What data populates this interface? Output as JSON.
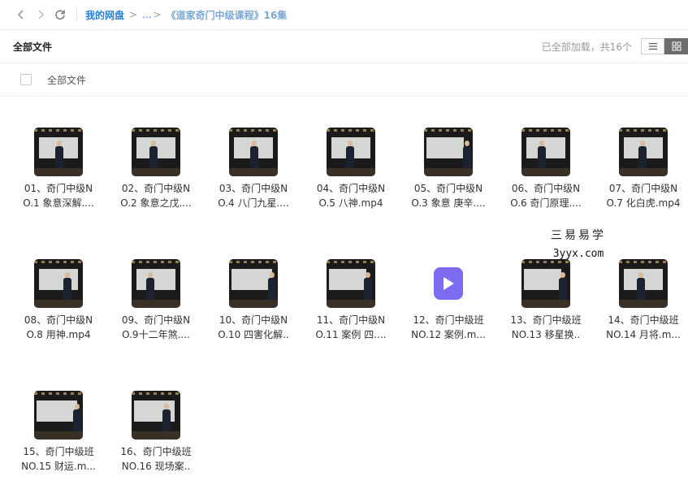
{
  "topbar": {
    "back_icon": "chevron-left-icon",
    "forward_icon": "chevron-right-icon",
    "refresh_icon": "refresh-icon",
    "breadcrumb": {
      "root": "我的网盘",
      "ellipsis": "...",
      "current": "《道家奇门中级课程》16集"
    }
  },
  "header": {
    "title": "全部文件",
    "status": "已全部加载，共16个",
    "view_list_icon": "list-view-icon",
    "view_grid_icon": "grid-view-icon"
  },
  "select_all": {
    "label": "全部文件"
  },
  "files": [
    {
      "line1": "01、奇门中级N",
      "line2": "O.1 象意深解...."
    },
    {
      "line1": "02、奇门中级N",
      "line2": "O.2 象意之戊...."
    },
    {
      "line1": "03、奇门中级N",
      "line2": "O.4 八门九星...."
    },
    {
      "line1": "04、奇门中级N",
      "line2": "O.5 八神.mp4"
    },
    {
      "line1": "05、奇门中级N",
      "line2": "O.3 象意 庚辛...."
    },
    {
      "line1": "06、奇门中级N",
      "line2": "O.6 奇门原理...."
    },
    {
      "line1": "07、奇门中级N",
      "line2": "O.7 化白虎.mp4"
    },
    {
      "line1": "08、奇门中级N",
      "line2": "O.8 用神.mp4"
    },
    {
      "line1": "09、奇门中级N",
      "line2": "O.9十二年煞...."
    },
    {
      "line1": "10、奇门中级N",
      "line2": "O.10 四害化解.."
    },
    {
      "line1": "11、奇门中级N",
      "line2": "O.11 案例 四...."
    },
    {
      "line1": "12、奇门中级班",
      "line2": "NO.12 案例.m..."
    },
    {
      "line1": "13、奇门中级班",
      "line2": "NO.13 移星换.."
    },
    {
      "line1": "14、奇门中级班",
      "line2": "NO.14 月将.m..."
    },
    {
      "line1": "15、奇门中级班",
      "line2": "NO.15 财运.m..."
    },
    {
      "line1": "16、奇门中级班",
      "line2": "NO.16 现场案.."
    }
  ],
  "watermark": {
    "cn": "三易易学",
    "en": "3yyx.com"
  }
}
